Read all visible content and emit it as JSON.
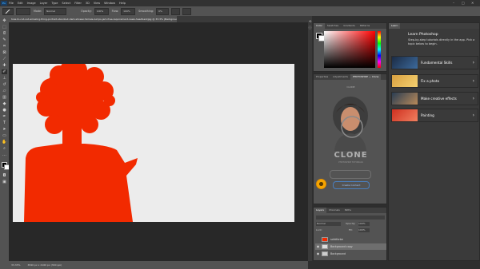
{
  "menubar": {
    "logo": "Ps",
    "items": [
      "File",
      "Edit",
      "Image",
      "Layer",
      "Type",
      "Select",
      "Filter",
      "3D",
      "View",
      "Window",
      "Help"
    ],
    "controls": [
      "–",
      "□",
      "✕"
    ]
  },
  "options": {
    "mode_label": "Mode:",
    "mode_value": "Normal",
    "opacity_label": "Opacity:",
    "opacity_value": "100%",
    "flow_label": "Flow:",
    "flow_value": "100%",
    "smoothing_label": "Smoothing:",
    "smoothing_value": "0%"
  },
  "document_tab": {
    "title": "how-to-cut-out-amazing-thing-portrait-standout-dark-shower-female-lumps-jam-free-requirement-news-headbankjpg @ 33.3% (Background, RGB/8) *"
  },
  "toolbar": {
    "icons": [
      "move-icon",
      "marquee-icon",
      "lasso-icon",
      "quick-select-icon",
      "crop-icon",
      "frame-icon",
      "eyedropper-icon",
      "healing-icon",
      "brush-icon",
      "stamp-icon",
      "history-brush-icon",
      "eraser-icon",
      "gradient-icon",
      "blur-icon",
      "dodge-icon",
      "pen-icon",
      "type-icon",
      "path-select-icon",
      "shape-icon",
      "hand-icon",
      "zoom-icon",
      "more-icon"
    ]
  },
  "status": {
    "zoom": "33.33%",
    "doc": "3840 px x 2160 px (300 ppi)"
  },
  "color_panel": {
    "tabs": [
      "Color",
      "Swatches",
      "Gradients",
      "Patterns"
    ],
    "active": "Color"
  },
  "properties_panel": {
    "tabs": [
      "Properties",
      "Adjustments",
      "PHOTOSHOP — Clone"
    ],
    "header": "CLONE",
    "logo_text": "CLONE",
    "logo_sub": "PHOTOSHOP TUTORIALS",
    "button_label": "Create Content"
  },
  "learn_panel": {
    "tab": "Learn",
    "title": "Learn Photoshop",
    "subtitle": "Step-by-step tutorials directly in the app. Pick a topic below to begin.",
    "items": [
      {
        "label": "Fundamental Skills"
      },
      {
        "label": "Fix a photo"
      },
      {
        "label": "Make creative effects"
      },
      {
        "label": "Painting"
      }
    ]
  },
  "layers_panel": {
    "tabs": [
      "Layers",
      "Channels",
      "Paths"
    ],
    "blend_mode": "Normal",
    "opacity_label": "Opacity:",
    "opacity_value": "100%",
    "lock_label": "Lock:",
    "fill_label": "Fill:",
    "fill_value": "100%",
    "layers": [
      {
        "name": "solidfarbe",
        "selected": false
      },
      {
        "name": "Background copy",
        "selected": true
      },
      {
        "name": "Background",
        "selected": false
      }
    ]
  },
  "colors": {
    "accent": "#31a8ff",
    "silhouette": "#f22a00",
    "canvas": "#ececec"
  }
}
